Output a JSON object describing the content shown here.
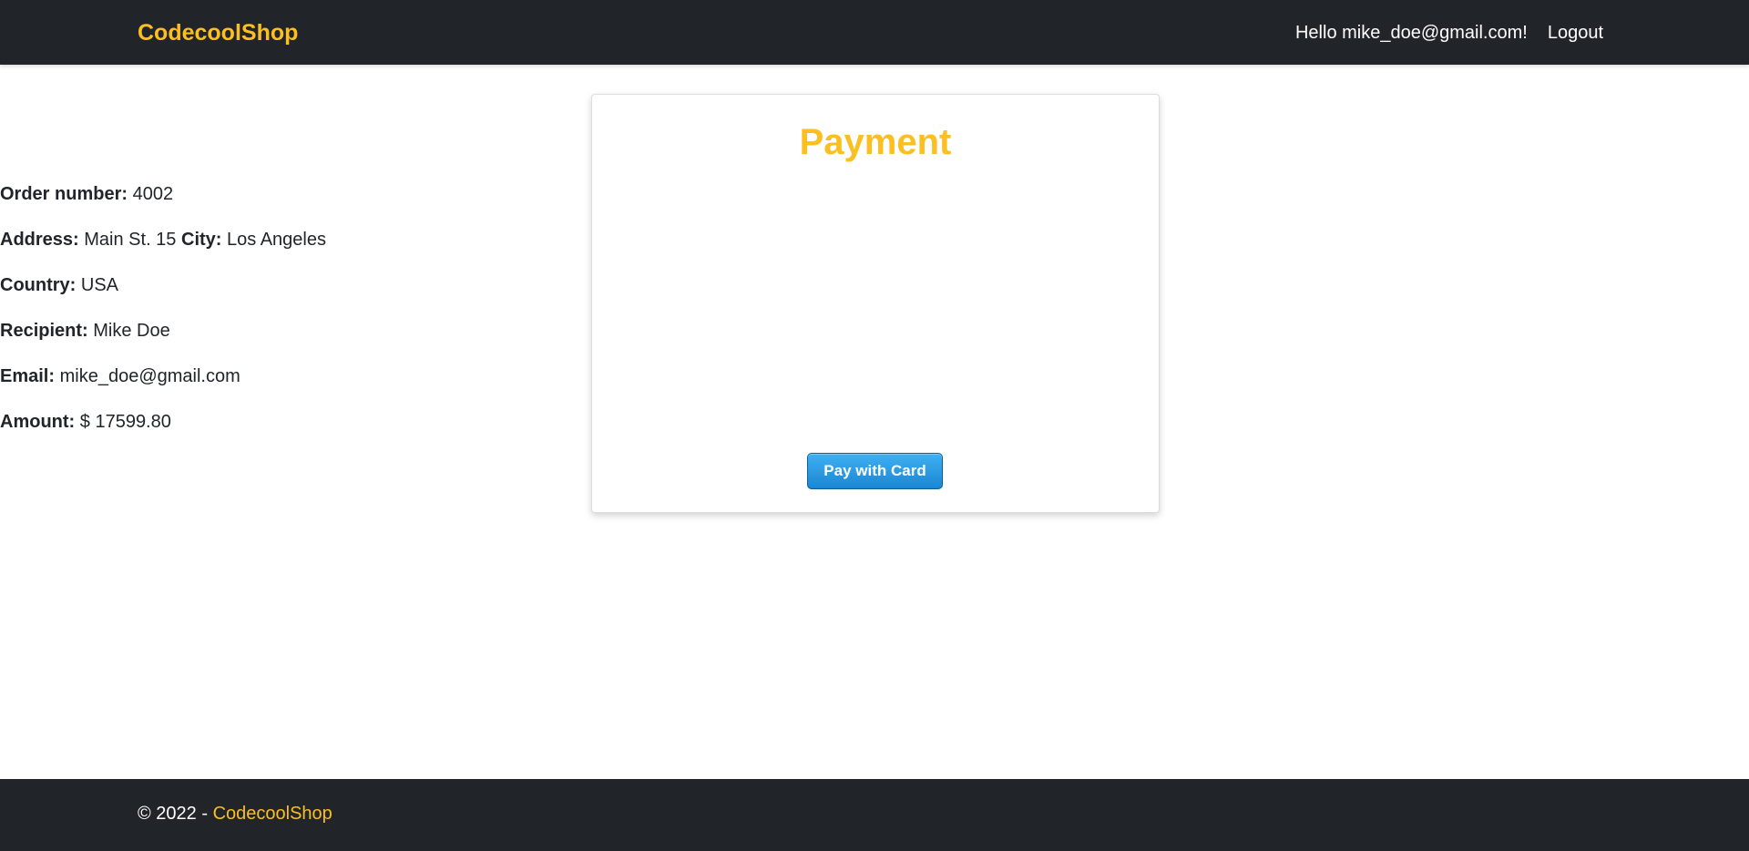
{
  "navbar": {
    "brand": "CodecoolShop",
    "greeting": "Hello mike_doe@gmail.com!",
    "logout_label": "Logout"
  },
  "payment": {
    "title": "Payment",
    "order_label": "Order number:",
    "order_value": "4002",
    "address_label": "Address:",
    "address_value": "Main St. 15",
    "city_label": "City:",
    "city_value": "Los Angeles",
    "country_label": "Country:",
    "country_value": "USA",
    "recipient_label": "Recipient:",
    "recipient_value": "Mike Doe",
    "email_label": "Email:",
    "email_value": "mike_doe@gmail.com",
    "amount_label": "Amount:",
    "amount_value": "$ 17599.80",
    "pay_button_label": "Pay with Card"
  },
  "footer": {
    "copyright": "© 2022 -",
    "link_label": "CodecoolShop"
  },
  "colors": {
    "accent": "#fbbf22",
    "dark_bar": "#212529",
    "pay_button": "#1a87d3"
  }
}
